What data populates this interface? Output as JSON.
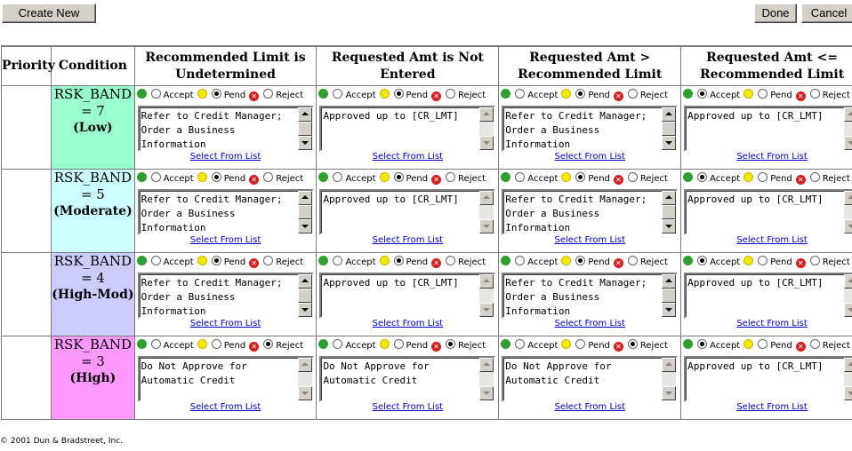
{
  "toolbar": {
    "create_label": "Create New",
    "done_label": "Done",
    "cancel_label": "Cancel"
  },
  "headers": {
    "priority": "Priority",
    "condition": "Condition",
    "cols": [
      "Recommended Limit is Undetermined",
      "Requested Amt is Not Entered",
      "Requested Amt > Recommended Limit",
      "Requested Amt <= Recommended Limit"
    ]
  },
  "labels": {
    "accept": "Accept",
    "pend": "Pend",
    "reject": "Reject",
    "select_from_list": "Select From List"
  },
  "colors": {
    "low": "#99ffcc",
    "moderate": "#ccffff",
    "high_mod": "#ccccff",
    "high": "#ff99ff"
  },
  "rows": [
    {
      "band": "RSK_BAND = 7",
      "level": "(Low)",
      "color": "#99ffcc",
      "cells": [
        {
          "decision": "pend",
          "text": "Refer to Credit Manager; Order a Business Information"
        },
        {
          "decision": "pend",
          "text": "Approved up to [CR_LMT]"
        },
        {
          "decision": "pend",
          "text": "Refer to Credit Manager; Order a Business Information"
        },
        {
          "decision": "accept",
          "text": "Approved up to [CR_LMT]"
        }
      ]
    },
    {
      "band": "RSK_BAND = 5",
      "level": "(Moderate)",
      "color": "#ccffff",
      "cells": [
        {
          "decision": "pend",
          "text": "Refer to Credit Manager; Order a Business Information"
        },
        {
          "decision": "pend",
          "text": "Approved up to [CR_LMT]"
        },
        {
          "decision": "pend",
          "text": "Refer to Credit Manager; Order a Business Information"
        },
        {
          "decision": "accept",
          "text": "Approved up to [CR_LMT]"
        }
      ]
    },
    {
      "band": "RSK_BAND = 4",
      "level": "(High-Mod)",
      "color": "#ccccff",
      "cells": [
        {
          "decision": "pend",
          "text": "Refer to Credit Manager; Order a Business Information"
        },
        {
          "decision": "pend",
          "text": "Approved up to [CR_LMT]"
        },
        {
          "decision": "pend",
          "text": "Refer to Credit Manager; Order a Business Information"
        },
        {
          "decision": "accept",
          "text": "Approved up to [CR_LMT]"
        }
      ]
    },
    {
      "band": "RSK_BAND = 3",
      "level": "(High)",
      "color": "#ff99ff",
      "cells": [
        {
          "decision": "reject",
          "text": "Do Not Approve for Automatic Credit"
        },
        {
          "decision": "reject",
          "text": "Do Not Approve for Automatic Credit"
        },
        {
          "decision": "reject",
          "text": "Do Not Approve for Automatic Credit"
        },
        {
          "decision": "accept",
          "text": "Approved up to [CR_LMT]"
        }
      ]
    }
  ],
  "footer": {
    "copyright": "© 2001 Dun & Bradstreet, Inc."
  }
}
